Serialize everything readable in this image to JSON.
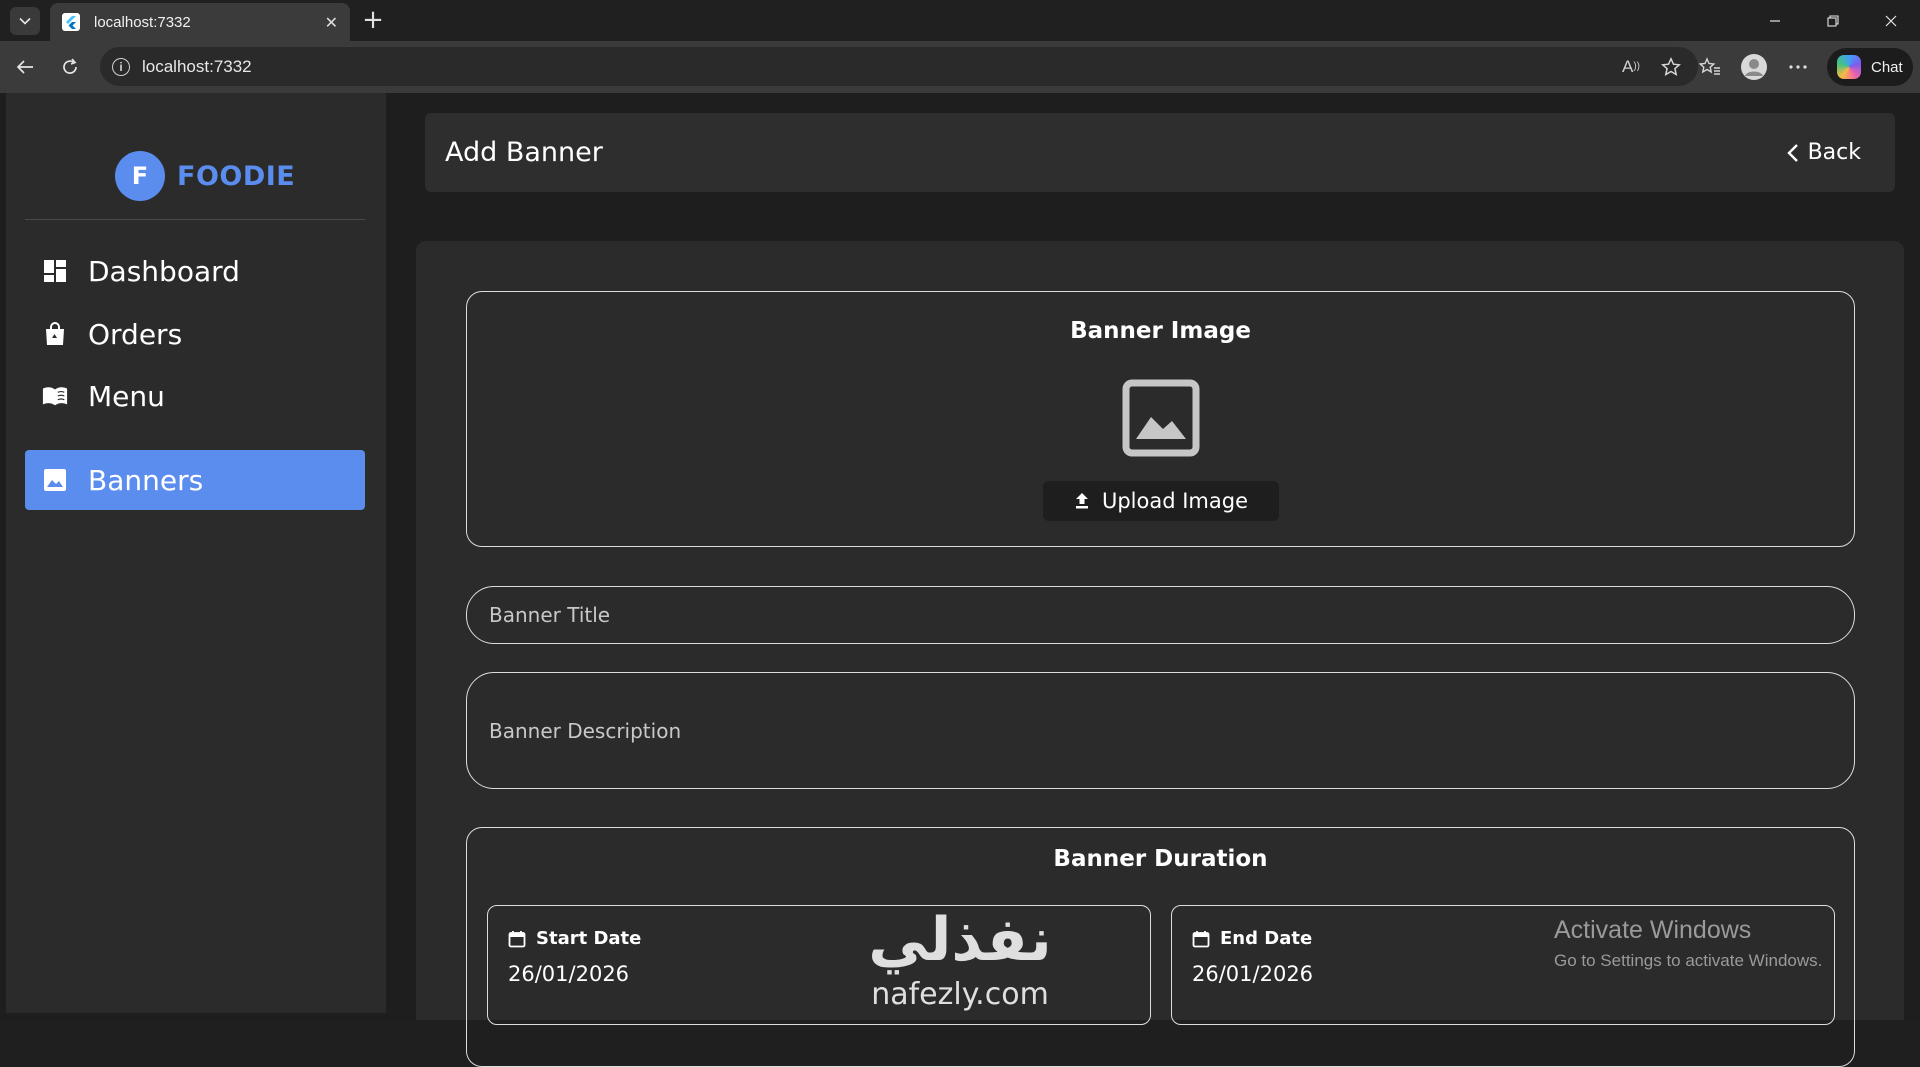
{
  "browser": {
    "tab_title": "localhost:7332",
    "tab_close": "✕",
    "new_tab": "+",
    "url": "localhost:7332",
    "info_glyph": "i",
    "chat_label": "Chat",
    "icons": [
      "tab-list-icon",
      "flutter-favicon",
      "back-arrow-icon",
      "reload-icon",
      "info-icon",
      "read-aloud-icon",
      "favorite-star-icon",
      "favorites-icon",
      "profile-icon",
      "more-icon",
      "copilot-icon",
      "minimize-icon",
      "restore-icon",
      "close-icon"
    ]
  },
  "sidebar": {
    "logo_letter": "F",
    "logo_text": "FOODIE",
    "items": [
      {
        "label": "Dashboard",
        "icon": "dashboard-icon",
        "active": false
      },
      {
        "label": "Orders",
        "icon": "shopping-bag-icon",
        "active": false
      },
      {
        "label": "Menu",
        "icon": "menu-book-icon",
        "active": false
      },
      {
        "label": "Banners",
        "icon": "image-icon",
        "active": true
      }
    ]
  },
  "header": {
    "title": "Add Banner",
    "back_label": "Back"
  },
  "form": {
    "image_section_title": "Banner Image",
    "upload_label": "Upload Image",
    "title_placeholder": "Banner Title",
    "description_placeholder": "Banner Description",
    "duration_title": "Banner Duration",
    "start_label": "Start Date",
    "start_value": "26/01/2026",
    "end_label": "End Date",
    "end_value": "26/01/2026"
  },
  "overlay": {
    "activate_title": "Activate Windows",
    "activate_sub": "Go to Settings to activate Windows.",
    "watermark_arabic": "نفذلي",
    "watermark_latin": "nafezly.com"
  },
  "colors": {
    "accent": "#5b8def",
    "background": "#1e1e1e",
    "panel": "#2b2b2b"
  }
}
